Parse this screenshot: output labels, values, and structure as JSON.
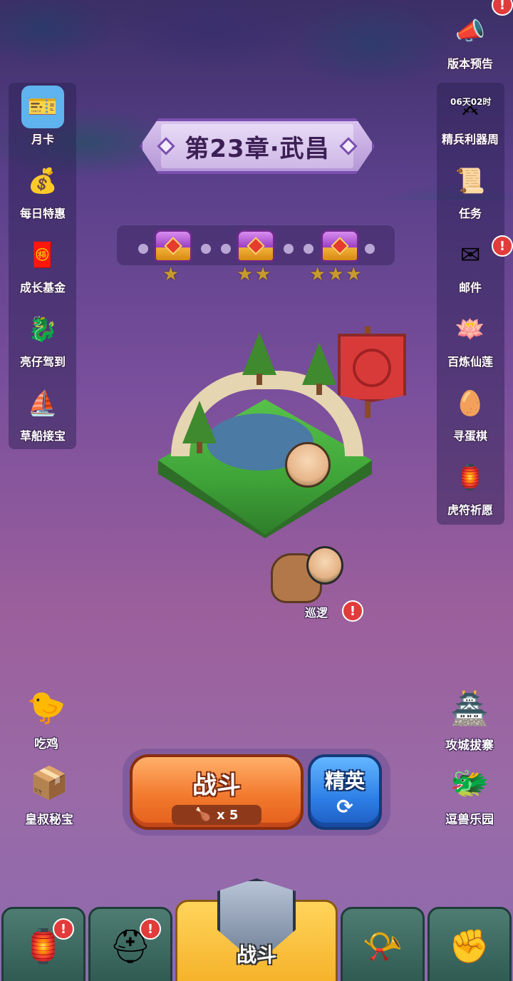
{
  "chapter": {
    "title": "第23章·武昌"
  },
  "left_menu": [
    {
      "label": "月卡",
      "icon": "monthly-card-icon",
      "glyph": "🎫"
    },
    {
      "label": "每日特惠",
      "icon": "gift-bag-icon",
      "glyph": "💰"
    },
    {
      "label": "成长基金",
      "icon": "growth-fund-icon",
      "glyph": "🧧"
    },
    {
      "label": "亮仔驾到",
      "icon": "hero-arrival-icon",
      "glyph": "🐉"
    },
    {
      "label": "草船接宝",
      "icon": "straw-boat-icon",
      "glyph": "⛵"
    }
  ],
  "right_menu": [
    {
      "label": "版本预告",
      "icon": "announcement-icon",
      "glyph": "📣",
      "alert": true
    },
    {
      "label": "精兵利器周",
      "icon": "weapon-week-icon",
      "glyph": "⚔",
      "timer": "06天02时"
    },
    {
      "label": "任务",
      "icon": "quest-scroll-icon",
      "glyph": "📜"
    },
    {
      "label": "邮件",
      "icon": "mail-icon",
      "glyph": "✉",
      "alert": true
    },
    {
      "label": "百炼仙莲",
      "icon": "lotus-icon",
      "glyph": "🪷"
    },
    {
      "label": "寻蛋棋",
      "icon": "egg-icon",
      "glyph": "🥚"
    },
    {
      "label": "虎符祈愿",
      "icon": "tiger-tally-icon",
      "glyph": "🏮"
    }
  ],
  "progress": {
    "milestones": [
      {
        "stars": 1
      },
      {
        "stars": 2
      },
      {
        "stars": 3
      }
    ]
  },
  "patrol": {
    "label": "巡逻",
    "alert": true
  },
  "bottom_left_features": [
    {
      "label": "吃鸡",
      "icon": "chick-icon",
      "glyph": "🐤"
    },
    {
      "label": "皇叔秘宝",
      "icon": "uncle-treasure-icon",
      "glyph": "📦"
    }
  ],
  "bottom_right_features": [
    {
      "label": "攻城拔寨",
      "icon": "siege-gate-icon",
      "glyph": "🏯"
    },
    {
      "label": "逗兽乐园",
      "icon": "beast-park-icon",
      "glyph": "🐲"
    }
  ],
  "battle": {
    "fight_label": "战斗",
    "stamina_cost": "x 5",
    "elite_label": "精英"
  },
  "nav": {
    "tabs": [
      {
        "icon": "shop-gate-icon",
        "glyph": "🏮",
        "alert": true
      },
      {
        "icon": "helmet-icon",
        "glyph": "⛑",
        "alert": true
      },
      {
        "icon": "horn-icon",
        "glyph": "📯"
      },
      {
        "icon": "fist-upgrade-icon",
        "glyph": "✊"
      }
    ],
    "center_label": "战斗"
  },
  "colors": {
    "accent_orange": "#f27a2e",
    "accent_blue": "#2d7ee6",
    "alert_red": "#e23b3b",
    "banner_purple": "#7b4fb0"
  }
}
